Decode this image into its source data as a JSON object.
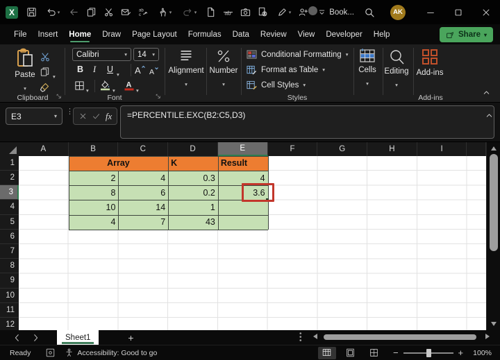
{
  "window": {
    "workbook_name": "Book...",
    "avatar_initials": "AK",
    "quick_access_icons": [
      "save",
      "undo",
      "back",
      "copy",
      "cut",
      "email-edit",
      "find-replace",
      "touch-mode",
      "redo",
      "new-file",
      "strikethrough",
      "camera",
      "doc-inspect",
      "draw-pen"
    ],
    "right_icons": [
      "add-people",
      "presence-circle",
      "qat-overflow",
      "search"
    ],
    "window_controls": [
      "minimize",
      "maximize",
      "close"
    ]
  },
  "ribbon_tabs": {
    "items": [
      "File",
      "Insert",
      "Home",
      "Draw",
      "Page Layout",
      "Formulas",
      "Data",
      "Review",
      "View",
      "Developer",
      "Help"
    ],
    "active": "Home",
    "share_label": "Share"
  },
  "ribbon": {
    "clipboard": {
      "group_label": "Clipboard",
      "paste_label": "Paste"
    },
    "font": {
      "group_label": "Font",
      "font_name": "Calibri",
      "font_size": "14",
      "bold": "B",
      "italic": "I",
      "underline": "U"
    },
    "alignment": {
      "label": "Alignment"
    },
    "number": {
      "label": "Number"
    },
    "styles": {
      "group_label": "Styles",
      "buttons": [
        "Conditional Formatting",
        "Format as Table",
        "Cell Styles"
      ]
    },
    "cells": {
      "label": "Cells"
    },
    "editing": {
      "label": "Editing"
    },
    "addins": {
      "button_label": "Add-ins",
      "group_label": "Add-ins"
    }
  },
  "formula_bar": {
    "cell_reference": "E3",
    "fx_label": "fx",
    "formula": "=PERCENTILE.EXC(B2:C5,D3)"
  },
  "sheet": {
    "columns": [
      "A",
      "B",
      "C",
      "D",
      "E",
      "F",
      "G",
      "H",
      "I"
    ],
    "rows": [
      "1",
      "2",
      "3",
      "4",
      "5",
      "6",
      "7",
      "8",
      "9",
      "10",
      "11",
      "12"
    ],
    "selected_column": "E",
    "selected_row": "3",
    "active_cell": "E3",
    "table": {
      "start_col_index": 1,
      "start_row": 1,
      "cells": [
        [
          {
            "text": "Array",
            "span": 2,
            "kind": "hdr",
            "align": "center"
          },
          {
            "text": "K",
            "span": 1,
            "kind": "hdr",
            "align": "left"
          },
          {
            "text": "Result",
            "span": 1,
            "kind": "hdr",
            "align": "left"
          }
        ],
        [
          {
            "text": "2"
          },
          {
            "text": "4"
          },
          {
            "text": "0.3"
          },
          {
            "text": "4"
          }
        ],
        [
          {
            "text": "8"
          },
          {
            "text": "6"
          },
          {
            "text": "0.2"
          },
          {
            "text": "3.6",
            "annotated": true
          }
        ],
        [
          {
            "text": "10"
          },
          {
            "text": "14"
          },
          {
            "text": "1"
          },
          {
            "text": ""
          }
        ],
        [
          {
            "text": "4"
          },
          {
            "text": "7"
          },
          {
            "text": "43"
          },
          {
            "text": ""
          }
        ]
      ]
    }
  },
  "sheet_tabs": {
    "tabs": [
      "Sheet1"
    ],
    "active": "Sheet1",
    "add_label": "+"
  },
  "status_bar": {
    "mode": "Ready",
    "accessibility": "Accessibility: Good to go",
    "zoom_level": "100%",
    "view_buttons": [
      "normal-view",
      "page-layout-view",
      "page-break-view"
    ]
  },
  "colors": {
    "table_header_orange": "#ED7D31",
    "table_cell_green": "#C6E0B4",
    "annotation_red": "#C2362B",
    "accent_green": "#2F7D4F",
    "share_button_green": "#4AA55C",
    "selected_header_gray": "#6B6B6B"
  }
}
